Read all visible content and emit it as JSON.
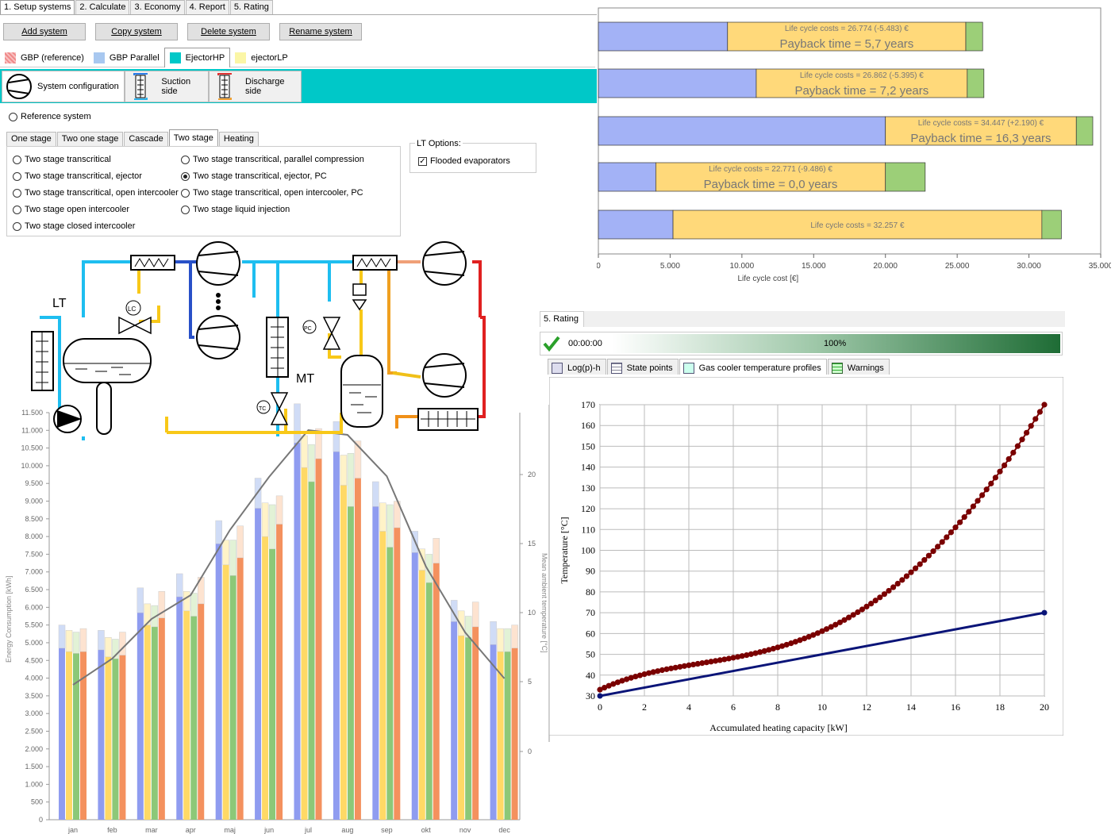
{
  "tabs": {
    "items": [
      "1. Setup systems",
      "2. Calculate",
      "3. Economy",
      "4. Report",
      "5. Rating"
    ],
    "active": 0
  },
  "buttons": {
    "add": "Add system",
    "copy": "Copy system",
    "delete": "Delete system",
    "rename": "Rename system"
  },
  "systems": [
    {
      "label": "GBP (reference)",
      "color": "#f4a3a3"
    },
    {
      "label": "GBP Parallel",
      "color": "#a8c8f0"
    },
    {
      "label": "EjectorHP",
      "color": "#00c8c8"
    },
    {
      "label": "ejectorLP",
      "color": "#fbf6a6"
    }
  ],
  "config_tabs": {
    "system": "System configuration",
    "suction": "Suction side",
    "discharge": "Discharge side"
  },
  "reference_system": "Reference system",
  "subtabs": [
    "One stage",
    "Two one stage",
    "Cascade",
    "Two stage",
    "Heating"
  ],
  "options_left": [
    "Two stage transcritical",
    "Two stage transcritical, ejector",
    "Two stage transcritical, open intercooler",
    "Two stage open intercooler",
    "Two stage closed intercooler"
  ],
  "options_right": [
    "Two stage transcritical, parallel compression",
    "Two stage transcritical, ejector, PC",
    "Two stage transcritical, open intercooler, PC",
    "Two stage liquid injection"
  ],
  "lt_options": {
    "title": "LT Options:",
    "flooded": "Flooded evaporators"
  },
  "diagram": {
    "lt": "LT",
    "mt": "MT",
    "lc": "LC",
    "pc": "PC",
    "tc": "TC"
  },
  "lcc_chart": {
    "xlabel": "Life cycle cost [€]",
    "xticks": [
      "0",
      "5.000",
      "10.000",
      "15.000",
      "20.000",
      "25.000",
      "30.000",
      "35.000"
    ],
    "xmax": 35000,
    "bars": [
      {
        "blue": 9000,
        "yellow": 16600,
        "green": 1174,
        "line1": "Life cycle costs = 26.774 (-5.483) €",
        "line2": "Payback time = 5,7 years"
      },
      {
        "blue": 11000,
        "yellow": 14700,
        "green": 1162,
        "line1": "Life cycle costs = 26.862 (-5.395) €",
        "line2": "Payback time = 7,2 years"
      },
      {
        "blue": 20000,
        "yellow": 13300,
        "green": 1147,
        "line1": "Life cycle costs = 34.447 (+2.190) €",
        "line2": "Payback time = 16,3 years"
      },
      {
        "blue": 4000,
        "yellow": 16000,
        "green": 2771,
        "line1": "Life cycle costs = 22.771 (-9.486) €",
        "line2": "Payback time = 0,0 years"
      },
      {
        "blue": 5200,
        "yellow": 25700,
        "green": 1357,
        "line1": "Life cycle costs = 32.257 €",
        "line2": ""
      }
    ]
  },
  "energy_chart": {
    "ylabel": "Energy Consumption [kWh]",
    "y2label": "Mean ambient temperature [°C]",
    "yticks": [
      "0",
      "500",
      "1.000",
      "1.500",
      "2.000",
      "2.500",
      "3.000",
      "3.500",
      "4.000",
      "4.500",
      "5.000",
      "5.500",
      "6.000",
      "6.500",
      "7.000",
      "7.500",
      "8.000",
      "8.500",
      "9.000",
      "9.500",
      "10.000",
      "10.500",
      "11.000",
      "11.500"
    ],
    "y2ticks": [
      "0",
      "5",
      "10",
      "15",
      "20"
    ],
    "months": [
      "jan",
      "feb",
      "mar",
      "apr",
      "maj",
      "jun",
      "jul",
      "aug",
      "sep",
      "okt",
      "nov",
      "dec"
    ],
    "series_colors": [
      "#8f9cf0",
      "#ffd966",
      "#8cc878",
      "#f4915e"
    ],
    "top_colors": [
      "#d0dcf6",
      "#fff3c8",
      "#e2f2d6",
      "#fde3d0"
    ],
    "base": [
      [
        4850,
        4750,
        4700,
        4750
      ],
      [
        4800,
        4600,
        4550,
        4650
      ],
      [
        5850,
        5500,
        5450,
        5700
      ],
      [
        6300,
        5900,
        5750,
        6100
      ],
      [
        7800,
        7200,
        6900,
        7400
      ],
      [
        8800,
        8000,
        7650,
        8350
      ],
      [
        10650,
        9950,
        9550,
        10200
      ],
      [
        10400,
        9450,
        8850,
        9650
      ],
      [
        8850,
        8150,
        7700,
        8250
      ],
      [
        7550,
        7050,
        6700,
        7250
      ],
      [
        5600,
        5200,
        5150,
        5450
      ],
      [
        4950,
        4750,
        4750,
        4850
      ]
    ],
    "total": [
      [
        5500,
        5350,
        5300,
        5400
      ],
      [
        5350,
        5150,
        5100,
        5300
      ],
      [
        6550,
        6100,
        6050,
        6450
      ],
      [
        6950,
        6450,
        6400,
        6850
      ],
      [
        8450,
        7900,
        7900,
        8300
      ],
      [
        9650,
        8950,
        8900,
        9150
      ],
      [
        11750,
        10850,
        10600,
        11050
      ],
      [
        11250,
        10300,
        10350,
        10700
      ],
      [
        9550,
        8950,
        8900,
        9000
      ],
      [
        8150,
        7650,
        7500,
        7950
      ],
      [
        6200,
        5900,
        5750,
        6150
      ],
      [
        5600,
        5400,
        5400,
        5500
      ]
    ],
    "temperature": [
      4.7,
      6.6,
      9.5,
      11.2,
      15.9,
      19.8,
      23.1,
      22.8,
      20.0,
      13.6,
      8.5,
      5.1
    ],
    "ymax": 11500,
    "y2max": 23
  },
  "rating": {
    "title": "5. Rating",
    "time": "00:00:00",
    "percent": "100%",
    "progress": 1.0
  },
  "gc_tabs": [
    "Log(p)-h",
    "State points",
    "Gas cooler temperature profiles",
    "Warnings"
  ],
  "gc_chart": {
    "xlabel": "Accumulated heating capacity [kW]",
    "ylabel": "Temperature [°C]",
    "xticks": [
      "0",
      "2",
      "4",
      "6",
      "8",
      "10",
      "12",
      "14",
      "16",
      "18",
      "20"
    ],
    "yticks": [
      "30",
      "40",
      "50",
      "60",
      "70",
      "80",
      "90",
      "100",
      "110",
      "120",
      "130",
      "140",
      "150",
      "160",
      "170"
    ],
    "xlim": [
      0,
      20
    ],
    "ylim": [
      30,
      170
    ],
    "water": {
      "start": [
        0,
        30
      ],
      "end": [
        20,
        70
      ],
      "color": "#0a1478"
    },
    "co2": {
      "color": "#7a0000",
      "t0": 33,
      "t20": 170
    }
  }
}
